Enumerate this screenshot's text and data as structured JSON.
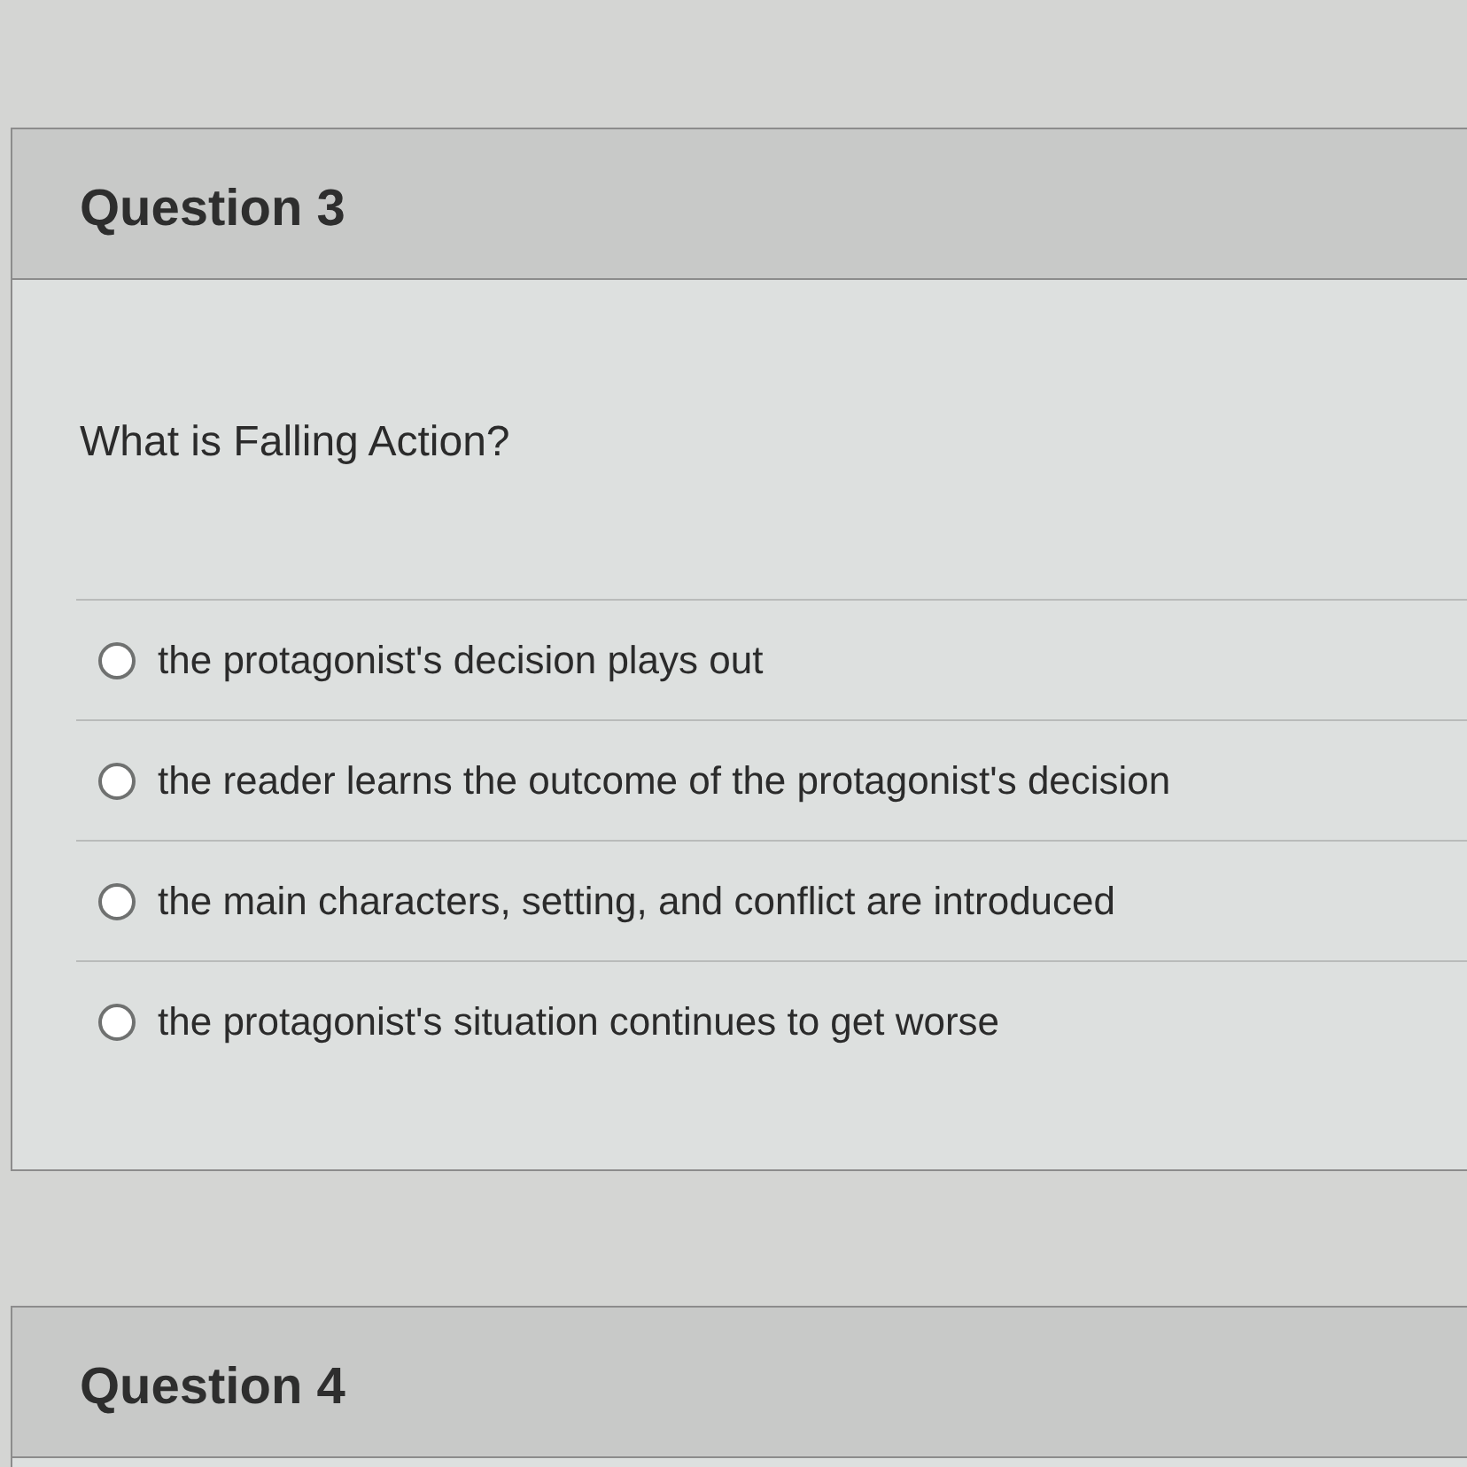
{
  "questions": [
    {
      "title": "Question 3",
      "prompt": "What is Falling Action?",
      "answers": [
        {
          "text": "the protagonist's decision plays out",
          "selected": false
        },
        {
          "text": "the reader learns the outcome of the protagonist's decision",
          "selected": false
        },
        {
          "text": "the main characters, setting, and conflict are introduced",
          "selected": false
        },
        {
          "text": "the protagonist's situation continues to get worse",
          "selected": false
        }
      ]
    },
    {
      "title": "Question 4"
    }
  ]
}
